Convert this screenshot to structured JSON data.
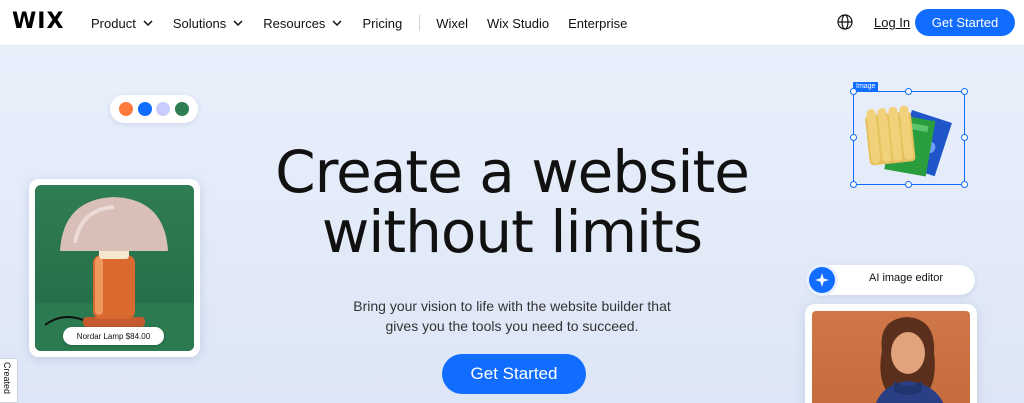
{
  "header": {
    "logo": "WIX",
    "nav": [
      {
        "label": "Product",
        "has_dropdown": true
      },
      {
        "label": "Solutions",
        "has_dropdown": true
      },
      {
        "label": "Resources",
        "has_dropdown": true
      },
      {
        "label": "Pricing",
        "has_dropdown": false
      }
    ],
    "nav_secondary": [
      {
        "label": "Wixel"
      },
      {
        "label": "Wix Studio"
      },
      {
        "label": "Enterprise"
      }
    ],
    "language_icon": "globe-icon",
    "login_label": "Log In",
    "cta_label": "Get Started"
  },
  "hero": {
    "headline_line1": "Create a website",
    "headline_line2": "without limits",
    "subtitle_line1": "Bring your vision to life with the website builder that",
    "subtitle_line2": "gives you the tools you need to succeed.",
    "cta_label": "Get Started",
    "color_swatches": [
      "#ff7a3d",
      "#116dff",
      "#c9ccff",
      "#2f7d53"
    ],
    "product_card": {
      "price_label": "Nordar Lamp $84.00"
    },
    "image_selection": {
      "tag_label": "Image"
    },
    "ai_pill": {
      "label": "AI image editor",
      "icon": "sparkle-icon"
    },
    "created_tab": {
      "label": "Created"
    }
  },
  "colors": {
    "accent": "#116dff",
    "hero_bg": "#e4ebf8",
    "lamp_bg": "#2f7d53",
    "photo_bg": "#c96f40"
  }
}
